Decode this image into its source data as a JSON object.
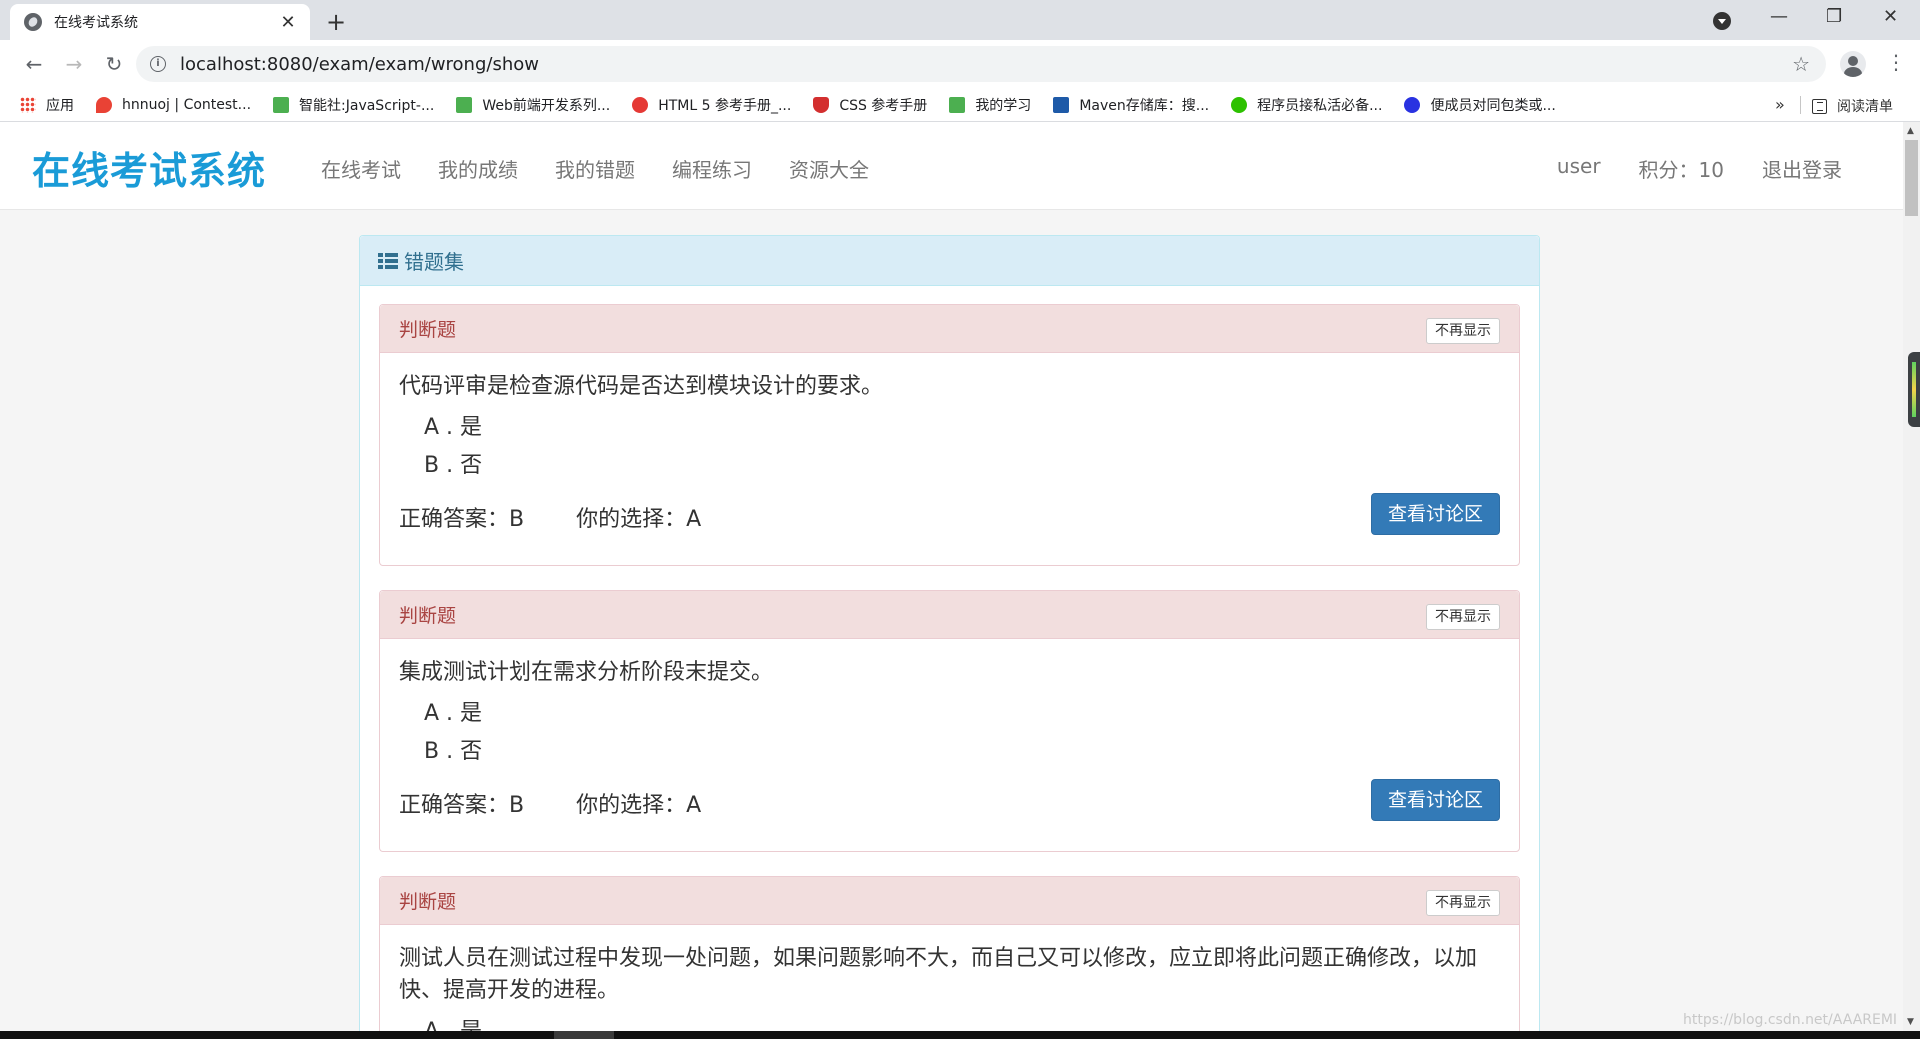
{
  "browser": {
    "tab_title": "在线考试系统",
    "tab_close": "✕",
    "new_tab": "+",
    "window_controls": [
      "—",
      "❐",
      "✕"
    ],
    "url": "localhost:8080/exam/exam/wrong/show",
    "nav": {
      "back": "←",
      "forward": "→",
      "reload": "↻"
    },
    "bookmarks": [
      {
        "label": "应用",
        "color": "#ea4335"
      },
      {
        "label": "hnnuoj | Contest...",
        "color": "#e94235"
      },
      {
        "label": "智能社:JavaScript-...",
        "color": "#4caf50"
      },
      {
        "label": "Web前端开发系列...",
        "color": "#4caf50"
      },
      {
        "label": "HTML 5 参考手册_...",
        "color": "#e53935"
      },
      {
        "label": "CSS 参考手册",
        "color": "#d32f2f"
      },
      {
        "label": "我的学习",
        "color": "#4caf50"
      },
      {
        "label": "Maven存储库：搜...",
        "color": "#1e5aa8"
      },
      {
        "label": "程序员接私活必备...",
        "color": "#2dc100"
      },
      {
        "label": "便成员对同包类或...",
        "color": "#2932e1"
      }
    ],
    "bookmarks_more": "»",
    "reading_list": "阅读清单"
  },
  "site": {
    "brand": "在线考试系统",
    "nav_links": [
      "在线考试",
      "我的成绩",
      "我的错题",
      "编程练习",
      "资源大全"
    ],
    "user": "user",
    "points": "积分：10",
    "logout": "退出登录"
  },
  "panel": {
    "title": "错题集"
  },
  "questions": [
    {
      "type": "判断题",
      "hide_label": "不再显示",
      "text": "代码评审是检查源代码是否达到模块设计的要求。",
      "options": [
        "A . 是",
        "B . 否"
      ],
      "correct": "正确答案：B",
      "chosen": "你的选择：A",
      "discuss_label": "查看讨论区"
    },
    {
      "type": "判断题",
      "hide_label": "不再显示",
      "text": "集成测试计划在需求分析阶段末提交。",
      "options": [
        "A . 是",
        "B . 否"
      ],
      "correct": "正确答案：B",
      "chosen": "你的选择：A",
      "discuss_label": "查看讨论区"
    },
    {
      "type": "判断题",
      "hide_label": "不再显示",
      "text": "测试人员在测试过程中发现一处问题，如果问题影响不大，而自己又可以修改，应立即将此问题正确修改，以加快、提高开发的进程。",
      "options": [
        "A . 是"
      ]
    }
  ],
  "watermark": "https://blog.csdn.net/AAAREMI"
}
